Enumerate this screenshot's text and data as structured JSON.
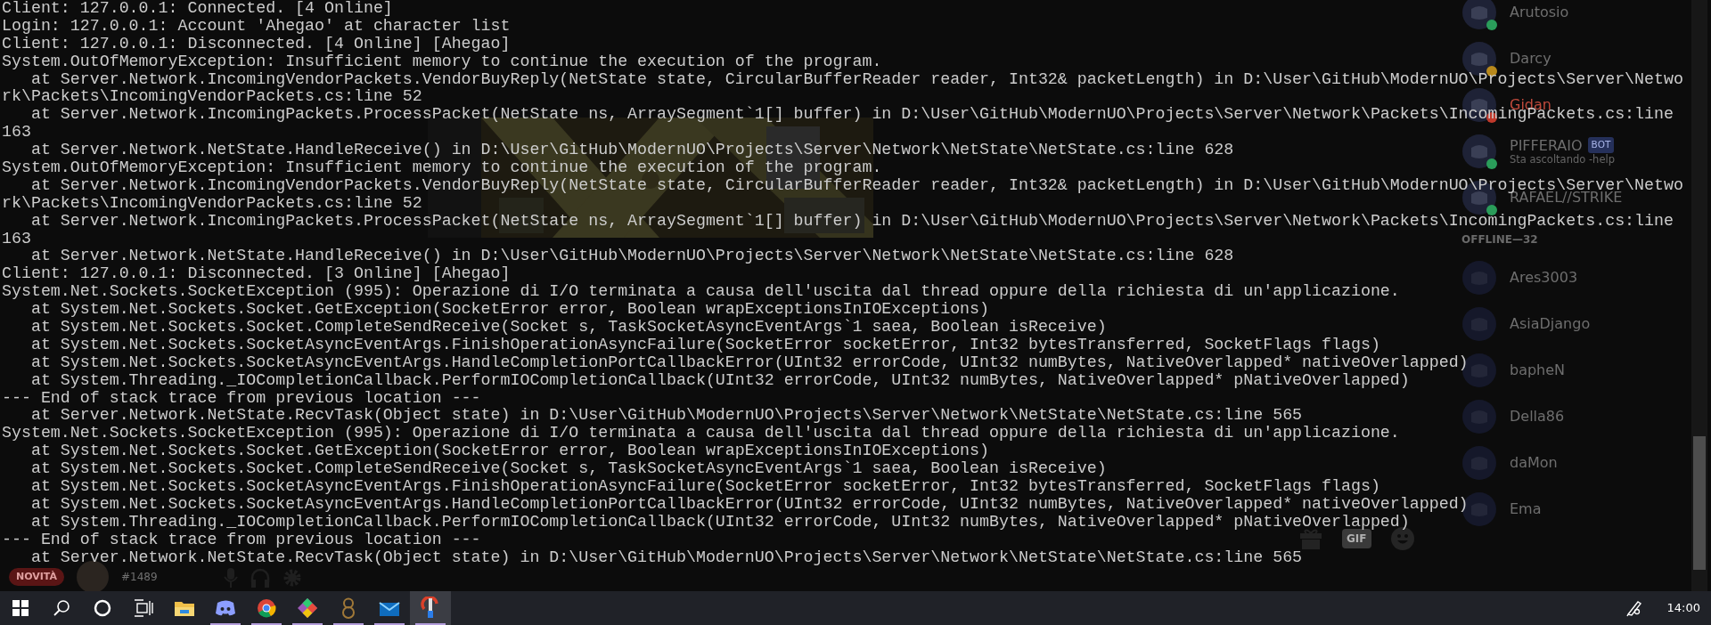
{
  "console": {
    "lines": [
      "Client: 127.0.0.1: Connected. [4 Online]",
      "Login: 127.0.0.1: Account 'Ahegao' at character list",
      "Client: 127.0.0.1: Disconnected. [4 Online] [Ahegao]",
      "System.OutOfMemoryException: Insufficient memory to continue the execution of the program.",
      "   at Server.Network.IncomingVendorPackets.VendorBuyReply(NetState state, CircularBufferReader reader, Int32& packetLength) in D:\\User\\GitHub\\ModernUO\\Projects\\Server\\Netwo",
      "rk\\Packets\\IncomingVendorPackets.cs:line 52",
      "   at Server.Network.IncomingPackets.ProcessPacket(NetState ns, ArraySegment`1[] buffer) in D:\\User\\GitHub\\ModernUO\\Projects\\Server\\Network\\Packets\\IncomingPackets.cs:line",
      "163",
      "   at Server.Network.NetState.HandleReceive() in D:\\User\\GitHub\\ModernUO\\Projects\\Server\\Network\\NetState\\NetState.cs:line 628",
      "System.OutOfMemoryException: Insufficient memory to continue the execution of the program.",
      "   at Server.Network.IncomingVendorPackets.VendorBuyReply(NetState state, CircularBufferReader reader, Int32& packetLength) in D:\\User\\GitHub\\ModernUO\\Projects\\Server\\Netwo",
      "rk\\Packets\\IncomingVendorPackets.cs:line 52",
      "   at Server.Network.IncomingPackets.ProcessPacket(NetState ns, ArraySegment`1[] buffer) in D:\\User\\GitHub\\ModernUO\\Projects\\Server\\Network\\Packets\\IncomingPackets.cs:line",
      "163",
      "   at Server.Network.NetState.HandleReceive() in D:\\User\\GitHub\\ModernUO\\Projects\\Server\\Network\\NetState\\NetState.cs:line 628",
      "Client: 127.0.0.1: Disconnected. [3 Online] [Ahegao]",
      "System.Net.Sockets.SocketException (995): Operazione di I/O terminata a causa dell'uscita dal thread oppure della richiesta di un'applicazione.",
      "   at System.Net.Sockets.Socket.GetException(SocketError error, Boolean wrapExceptionsInIOExceptions)",
      "   at System.Net.Sockets.Socket.CompleteSendReceive(Socket s, TaskSocketAsyncEventArgs`1 saea, Boolean isReceive)",
      "   at System.Net.Sockets.SocketAsyncEventArgs.FinishOperationAsyncFailure(SocketError socketError, Int32 bytesTransferred, SocketFlags flags)",
      "   at System.Net.Sockets.SocketAsyncEventArgs.HandleCompletionPortCallbackError(UInt32 errorCode, UInt32 numBytes, NativeOverlapped* nativeOverlapped)",
      "   at System.Threading._IOCompletionCallback.PerformIOCompletionCallback(UInt32 errorCode, UInt32 numBytes, NativeOverlapped* pNativeOverlapped)",
      "--- End of stack trace from previous location ---",
      "   at Server.Network.NetState.RecvTask(Object state) in D:\\User\\GitHub\\ModernUO\\Projects\\Server\\Network\\NetState\\NetState.cs:line 565",
      "System.Net.Sockets.SocketException (995): Operazione di I/O terminata a causa dell'uscita dal thread oppure della richiesta di un'applicazione.",
      "   at System.Net.Sockets.Socket.GetException(SocketError error, Boolean wrapExceptionsInIOExceptions)",
      "   at System.Net.Sockets.Socket.CompleteSendReceive(Socket s, TaskSocketAsyncEventArgs`1 saea, Boolean isReceive)",
      "   at System.Net.Sockets.SocketAsyncEventArgs.FinishOperationAsyncFailure(SocketError socketError, Int32 bytesTransferred, SocketFlags flags)",
      "   at System.Net.Sockets.SocketAsyncEventArgs.HandleCompletionPortCallbackError(UInt32 errorCode, UInt32 numBytes, NativeOverlapped* nativeOverlapped)",
      "   at System.Threading._IOCompletionCallback.PerformIOCompletionCallback(UInt32 errorCode, UInt32 numBytes, NativeOverlapped* pNativeOverlapped)",
      "--- End of stack trace from previous location ---",
      "   at Server.Network.NetState.RecvTask(Object state) in D:\\User\\GitHub\\ModernUO\\Projects\\Server\\Network\\NetState\\NetState.cs:line 565"
    ]
  },
  "chat": {
    "toolbar": {
      "gif": "GIF"
    }
  },
  "user_panel": {
    "badge": "NOVITÀ",
    "tag": "#1489"
  },
  "members": {
    "online": [
      {
        "name": "Arutosio",
        "color": "#2a9d5a",
        "kind": "plain"
      },
      {
        "name": "Darcy",
        "color": "#b8891c",
        "kind": "plain"
      },
      {
        "name": "Gidan",
        "color": "#c0392b",
        "kind": "role"
      },
      {
        "name": "PIFFERAIO",
        "color": "#2a9d5a",
        "kind": "plain",
        "tag": "BOT",
        "activity": "Sta ascoltando -help"
      },
      {
        "name": "RAFAEL//STRIKE",
        "color": "#2a9d5a",
        "kind": "plain"
      }
    ],
    "offline_header": "OFFLINE—32",
    "offline": [
      {
        "name": "Ares3003"
      },
      {
        "name": "AsiaDjango"
      },
      {
        "name": "bapheN"
      },
      {
        "name": "Della86"
      },
      {
        "name": "daMon"
      },
      {
        "name": "Ema"
      }
    ]
  },
  "taskbar": {
    "apps": [
      {
        "kind": "explorer",
        "running": false,
        "selected": false
      },
      {
        "kind": "discord",
        "running": true,
        "selected": false
      },
      {
        "kind": "chrome",
        "running": true,
        "selected": false
      },
      {
        "kind": "git",
        "running": true,
        "selected": false
      },
      {
        "kind": "eight",
        "running": true,
        "selected": false
      },
      {
        "kind": "mail",
        "running": true,
        "selected": false
      },
      {
        "kind": "tool",
        "running": true,
        "selected": true
      }
    ],
    "clock": "14:00"
  }
}
